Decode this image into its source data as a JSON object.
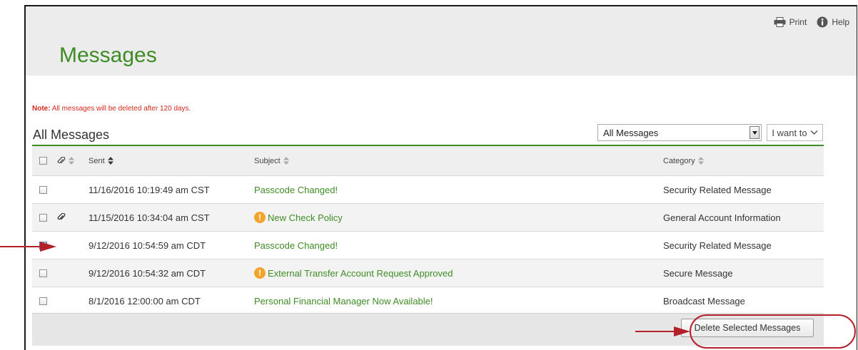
{
  "header": {
    "title": "Messages",
    "print_label": "Print",
    "help_label": "Help"
  },
  "note": {
    "prefix": "Note:",
    "text": " All messages will be deleted after 120 days."
  },
  "list": {
    "title": "All Messages",
    "filter_value": "All Messages",
    "i_want_to_label": "I want to"
  },
  "table": {
    "columns": {
      "sent": "Sent",
      "subject": "Subject",
      "category": "Category"
    },
    "rows": [
      {
        "checked": false,
        "attachment": false,
        "sent": "11/16/2016 10:19:49 am CST",
        "alert": false,
        "subject": "Passcode Changed!",
        "category": "Security Related Message"
      },
      {
        "checked": false,
        "attachment": true,
        "sent": "11/15/2016 10:34:04 am CST",
        "alert": true,
        "subject": "New Check Policy",
        "category": "General Account Information"
      },
      {
        "checked": true,
        "attachment": false,
        "sent": "9/12/2016 10:54:59 am CDT",
        "alert": false,
        "subject": "Passcode Changed!",
        "category": "Security Related Message"
      },
      {
        "checked": false,
        "attachment": false,
        "sent": "9/12/2016 10:54:32 am CDT",
        "alert": true,
        "subject": "External Transfer Account Request Approved",
        "category": "Secure Message"
      },
      {
        "checked": false,
        "attachment": false,
        "sent": "8/1/2016 12:00:00 am CDT",
        "alert": false,
        "subject": "Personal Financial Manager Now Available!",
        "category": "Broadcast Message"
      }
    ]
  },
  "footer": {
    "delete_label": "Delete Selected Messages"
  },
  "colors": {
    "brand_green": "#3f8c26",
    "note_red": "#d0291c",
    "callout_red": "#b3202a",
    "alert_orange": "#f3a42a"
  }
}
